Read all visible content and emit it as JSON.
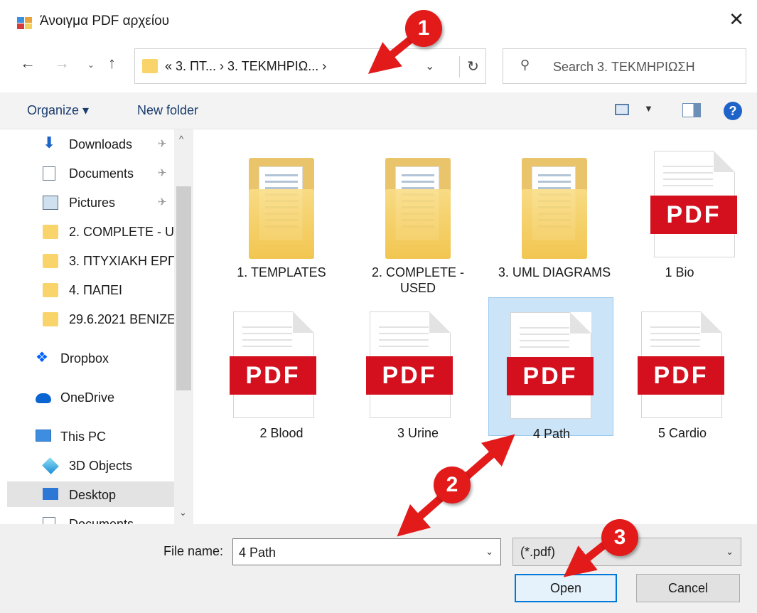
{
  "window": {
    "title": "Άνοιγμα PDF αρχείου",
    "close_glyph": "✕"
  },
  "nav": {
    "back": "←",
    "forward": "→",
    "recent": "⌄",
    "up": "↑"
  },
  "address": {
    "crumbs": "« 3. ΠΤ... › 3. ΤΕΚΜΗΡΙΩ... ›",
    "dropdown": "⌄",
    "refresh": "↻"
  },
  "search": {
    "placeholder": "Search 3. ΤΕΚΜΗΡΙΩΣΗ",
    "icon": "search-icon"
  },
  "toolbar": {
    "organize": "Organize ▾",
    "new_folder": "New folder",
    "view_drop": "▼",
    "help": "?"
  },
  "sidebar": {
    "items": [
      {
        "label": "Downloads",
        "icon": "download-icon",
        "pin": "✈"
      },
      {
        "label": "Documents",
        "icon": "document-icon",
        "pin": "✈"
      },
      {
        "label": "Pictures",
        "icon": "picture-icon",
        "pin": "✈"
      },
      {
        "label": "2. COMPLETE - U",
        "icon": "folder-icon"
      },
      {
        "label": "3. ΠΤΥΧΙΑΚΗ ΕΡΓ",
        "icon": "folder-icon"
      },
      {
        "label": "4. ΠΑΠΕΙ",
        "icon": "folder-icon"
      },
      {
        "label": "29.6.2021 ΒΕΝΙΖΕ",
        "icon": "folder-icon"
      },
      {
        "label": "Dropbox",
        "icon": "dropbox-icon"
      },
      {
        "label": "OneDrive",
        "icon": "onedrive-icon"
      },
      {
        "label": "This PC",
        "icon": "computer-icon"
      },
      {
        "label": "3D Objects",
        "icon": "3d-objects-icon"
      },
      {
        "label": "Desktop",
        "icon": "desktop-icon"
      },
      {
        "label": "Documents",
        "icon": "document-icon"
      }
    ],
    "scroll_up": "^",
    "scroll_down": "⌄"
  },
  "files": [
    {
      "name": "1. TEMPLATES",
      "type": "folder"
    },
    {
      "name": "2. COMPLETE - USED",
      "type": "folder"
    },
    {
      "name": "3. UML DIAGRAMS",
      "type": "folder"
    },
    {
      "name": "1 Bio",
      "type": "pdf"
    },
    {
      "name": "2 Blood",
      "type": "pdf"
    },
    {
      "name": "3 Urine",
      "type": "pdf"
    },
    {
      "name": "4 Path",
      "type": "pdf",
      "selected": true
    },
    {
      "name": "5 Cardio",
      "type": "pdf"
    }
  ],
  "pdf_label": "PDF",
  "footer": {
    "file_name_label": "File name:",
    "file_name_value": "4 Path",
    "filter_value": "(*.pdf)",
    "dropdown": "⌄",
    "open_label": "Open",
    "cancel_label": "Cancel"
  },
  "annotations": [
    {
      "number": "1"
    },
    {
      "number": "2"
    },
    {
      "number": "3"
    }
  ],
  "colors": {
    "accent": "#0078d7",
    "selection": "#cce4f7",
    "pdf_red": "#d4101f",
    "badge_red": "#e31a1a"
  }
}
